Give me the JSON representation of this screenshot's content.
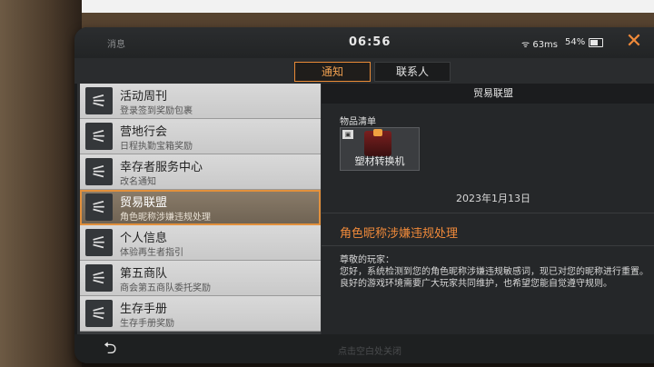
{
  "statusbar": {
    "messages_label": "消息",
    "time": "06:56",
    "network": "63ms",
    "battery": "54%"
  },
  "tabs": [
    {
      "label": "通知",
      "active": true
    },
    {
      "label": "联系人",
      "active": false
    }
  ],
  "list": [
    {
      "title": "活动周刊",
      "subtitle": "登录签到奖励包裹",
      "selected": false,
      "icon": "satellite-dish-icon"
    },
    {
      "title": "营地行会",
      "subtitle": "日程执勤宝箱奖励",
      "selected": false,
      "icon": "satellite-dish-icon"
    },
    {
      "title": "幸存者服务中心",
      "subtitle": "改名通知",
      "selected": false,
      "icon": "satellite-dish-icon"
    },
    {
      "title": "贸易联盟",
      "subtitle": "角色昵称涉嫌违规处理",
      "selected": true,
      "icon": "satellite-dish-icon"
    },
    {
      "title": "个人信息",
      "subtitle": "体验再生者指引",
      "selected": false,
      "icon": "satellite-dish-icon"
    },
    {
      "title": "第五商队",
      "subtitle": "商会第五商队委托奖励",
      "selected": false,
      "icon": "satellite-dish-icon"
    },
    {
      "title": "生存手册",
      "subtitle": "生存手册奖励",
      "selected": false,
      "icon": "satellite-dish-icon"
    }
  ],
  "detail": {
    "header": "贸易联盟",
    "items_label": "物品清单",
    "item_name": "塑材转换机",
    "date": "2023年1月13日",
    "subject": "角色昵称涉嫌违规处理",
    "body": [
      "尊敬的玩家：",
      "  您好，系统检测到您的角色昵称涉嫌违规敏感词，现已对您的昵称进行重置。",
      "良好的游戏环境需要广大玩家共同维护，也希望您能自觉遵守规则。"
    ]
  },
  "footer": {
    "hint": "点击空白处关闭"
  },
  "colors": {
    "accent": "#e98a36",
    "panel": "#2d2f31"
  }
}
